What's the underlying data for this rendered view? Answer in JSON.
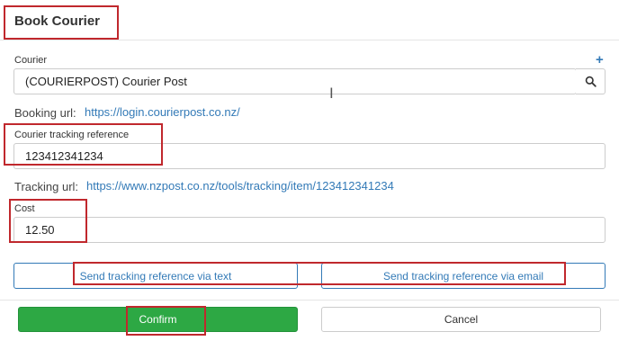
{
  "dialog": {
    "title": "Book Courier"
  },
  "courier": {
    "label": "Courier",
    "value": "(COURIERPOST) Courier Post",
    "add_icon": "plus-icon",
    "search_icon": "search-icon"
  },
  "booking": {
    "label": "Booking url:",
    "url": "https://login.courierpost.co.nz/"
  },
  "tracking_reference": {
    "label": "Courier tracking reference",
    "value": "123412341234"
  },
  "tracking": {
    "label": "Tracking url:",
    "url": "https://www.nzpost.co.nz/tools/tracking/item/123412341234"
  },
  "cost": {
    "label": "Cost",
    "value": "12.50"
  },
  "actions": {
    "send_text_label": "Send tracking reference via text",
    "send_email_label": "Send tracking reference via email",
    "confirm_label": "Confirm",
    "cancel_label": "Cancel"
  },
  "colors": {
    "primary_link": "#337ab7",
    "confirm_green": "#2da844",
    "highlight_red": "#c0282d"
  }
}
